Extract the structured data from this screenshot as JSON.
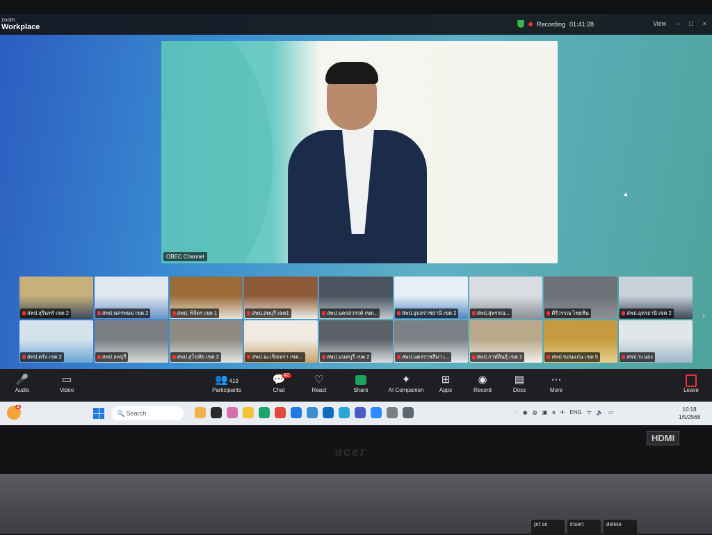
{
  "zoom": {
    "logo_top": "zoom",
    "logo_bottom": "Workplace",
    "recording_label": "Recording",
    "timer": "01:41:28",
    "view_label": "View",
    "stage_name": "OBEC Channel",
    "gallery": [
      {
        "label": "สพป.สุรินทร์ เขต 2",
        "c1": "#3c4a5c",
        "c2": "#c8b07a"
      },
      {
        "label": "สพป.นครพนม เขต 2",
        "c1": "#6b93c8",
        "c2": "#dfe7f0"
      },
      {
        "label": "สพป. พิจิตร เขต 1",
        "c1": "#e8e2d4",
        "c2": "#9b6b3a"
      },
      {
        "label": "สพป.ลพบุรี เขต1",
        "c1": "#f2efe8",
        "c2": "#8c5a38"
      },
      {
        "label": "สพป.นครสวรรค์ เขต...",
        "c1": "#bfc8cf",
        "c2": "#49545e"
      },
      {
        "label": "สพป.อุบลราชธานี เขต 2",
        "c1": "#4d86c4",
        "c2": "#e7eef5"
      },
      {
        "label": "สพป.สุพรรณ...",
        "c1": "#8a8f96",
        "c2": "#d9dce0"
      },
      {
        "label": "ศิริวรรณ ไชยหิน",
        "c1": "#8e9196",
        "c2": "#6d7076"
      },
      {
        "label": "สพป.อุดรธานี เขต 2",
        "c1": "#3e4857",
        "c2": "#c7d2db"
      },
      {
        "label": "สพป.ตรัง เขต 2",
        "c1": "#6aa6d6",
        "c2": "#d4e2ec"
      },
      {
        "label": "สพป.ลพบุรี",
        "c1": "#d7d9d6",
        "c2": "#7b7f84"
      },
      {
        "label": "สพป.สุโขทัย เขต 2",
        "c1": "#e5e6e3",
        "c2": "#8f8b84"
      },
      {
        "label": "สพป.ฉะเชิงเทรา เขต...",
        "c1": "#caa46e",
        "c2": "#f0ebe2"
      },
      {
        "label": "สพป.นนทบุรี เขต 2",
        "c1": "#dadcdf",
        "c2": "#5c6067"
      },
      {
        "label": "สพป.นครราชสีมา เ...",
        "c1": "#e8eaec",
        "c2": "#7c8187"
      },
      {
        "label": "สพป.กาฬสินธุ์ เขต 1",
        "c1": "#f1efe9",
        "c2": "#b9a98a"
      },
      {
        "label": "สพป.ขอนแก่น เขต 5",
        "c1": "#e6cf8e",
        "c2": "#c69a3f"
      },
      {
        "label": "สพป.ระนอง",
        "c1": "#9fb8c9",
        "c2": "#e1e6ea"
      }
    ],
    "controls": {
      "audio": "Audio",
      "video": "Video",
      "participants": "Participants",
      "participants_count": "419",
      "chat": "Chat",
      "chat_badge": "42",
      "react": "React",
      "share": "Share",
      "ai_companion": "AI Companion",
      "apps": "Apps",
      "record": "Record",
      "docs": "Docs",
      "more": "More",
      "leave": "Leave"
    }
  },
  "taskbar": {
    "search_placeholder": "Search",
    "widget_badge": "2",
    "language": "ENG",
    "time": "10:18",
    "date": "1/5/2568"
  },
  "hardware": {
    "brand": "acer",
    "port_label": "HDMI",
    "keys": [
      "prt sc",
      "insert",
      "delete"
    ]
  }
}
